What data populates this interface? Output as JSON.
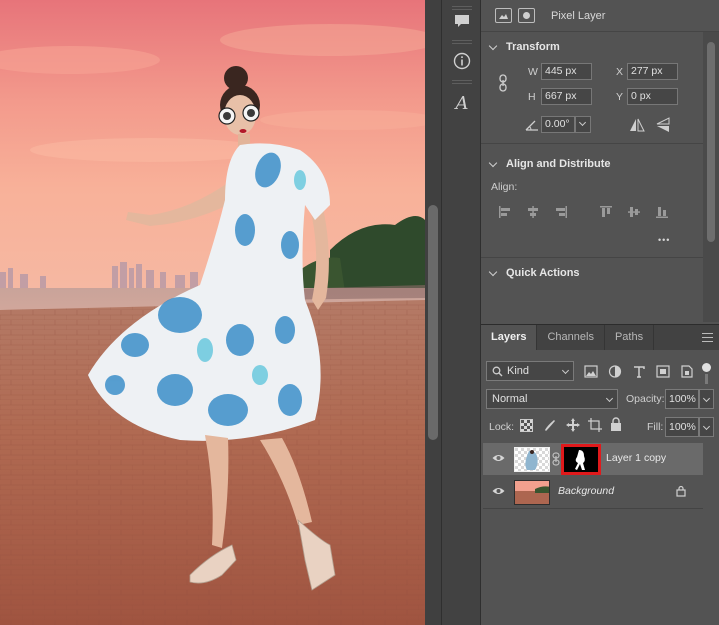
{
  "canvas": {
    "image": "fashion-model-photo"
  },
  "toolstrip": {
    "icons": [
      "comment-icon",
      "info-icon",
      "glyph-icon"
    ],
    "glyph_char": "A",
    "info_char": "i"
  },
  "properties": {
    "layer_type": "Pixel Layer",
    "transform": {
      "title": "Transform",
      "w_label": "W",
      "w_value": "445 px",
      "x_label": "X",
      "x_value": "277 px",
      "h_label": "H",
      "h_value": "667 px",
      "y_label": "Y",
      "y_value": "0 px",
      "angle_value": "0.00°"
    },
    "align": {
      "title": "Align and Distribute",
      "label": "Align:",
      "more": "•••"
    },
    "quick_actions": {
      "title": "Quick Actions"
    }
  },
  "layers_panel": {
    "tabs": [
      {
        "label": "Layers",
        "active": true
      },
      {
        "label": "Channels",
        "active": false
      },
      {
        "label": "Paths",
        "active": false
      }
    ],
    "filter_kind": "Kind",
    "blend_mode": "Normal",
    "opacity_label": "Opacity:",
    "opacity_value": "100%",
    "lock_label": "Lock:",
    "fill_label": "Fill:",
    "fill_value": "100%",
    "layers": [
      {
        "name": "Layer 1 copy",
        "selected": true,
        "has_mask": true
      },
      {
        "name": "Background",
        "selected": false,
        "locked": true
      }
    ],
    "colors": {
      "mask_highlight": "#e0191b",
      "panel_bg": "#535353",
      "selected_row": "#6a6a6a"
    }
  }
}
